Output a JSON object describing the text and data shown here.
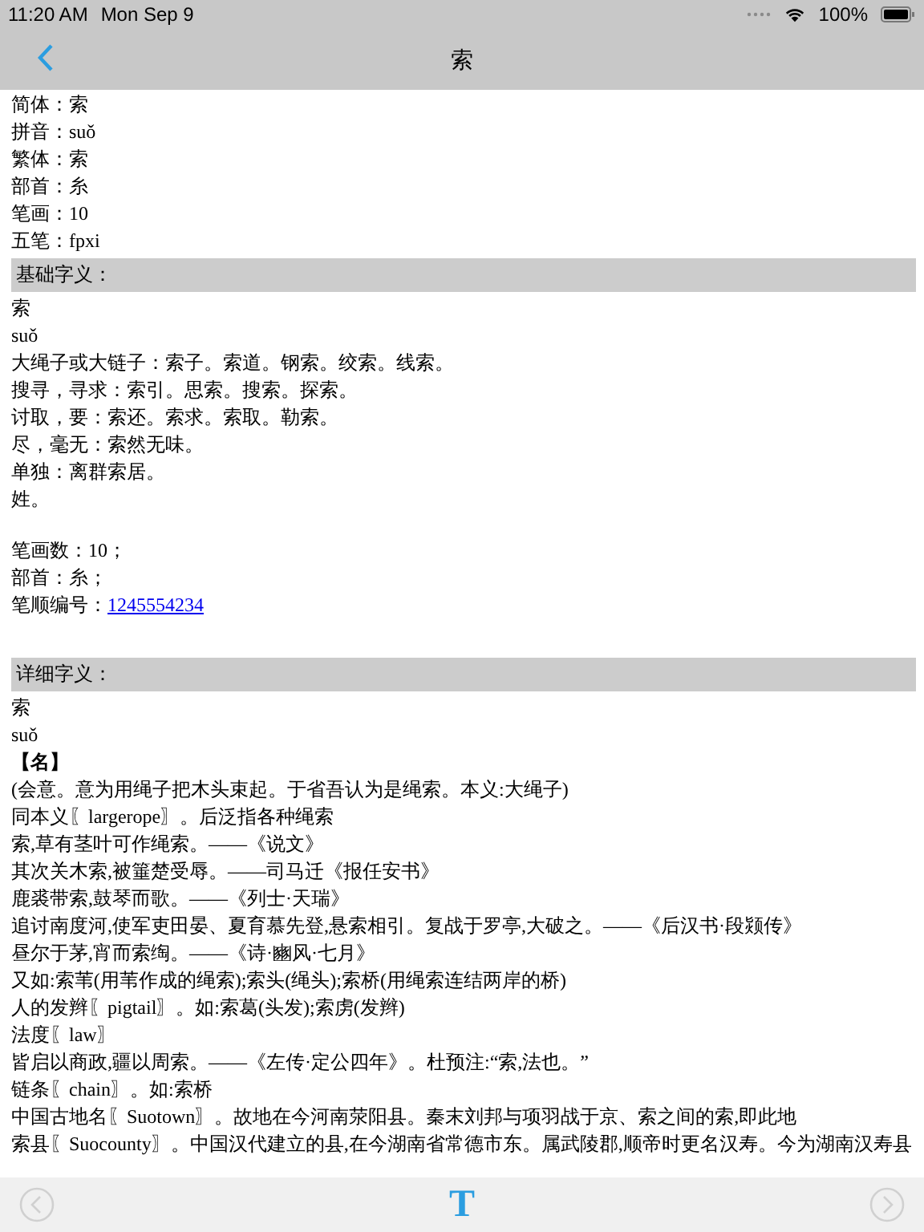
{
  "status_bar": {
    "time": "11:20 AM",
    "date": "Mon Sep 9",
    "battery": "100%"
  },
  "nav": {
    "title": "索"
  },
  "info": [
    {
      "label": "简体：",
      "value": "索"
    },
    {
      "label": "拼音：",
      "value": "suǒ"
    },
    {
      "label": "繁体：",
      "value": "索"
    },
    {
      "label": "部首：",
      "value": "糸"
    },
    {
      "label": "笔画：",
      "value": "10"
    },
    {
      "label": "五笔：",
      "value": "fpxi"
    }
  ],
  "basic_section": {
    "header": "基础字义：",
    "lines": [
      "索",
      "suǒ",
      "大绳子或大链子：索子。索道。钢索。绞索。线索。",
      "搜寻，寻求：索引。思索。搜索。探索。",
      "讨取，要：索还。索求。索取。勒索。",
      "尽，毫无：索然无味。",
      "单独：离群索居。",
      "姓。"
    ]
  },
  "stroke_info": [
    {
      "label": "笔画数：",
      "value": "10；",
      "kind": "plain"
    },
    {
      "label": "部首：",
      "value": "糸；",
      "kind": "plain"
    },
    {
      "label": "笔顺编号：",
      "value": "1245554234",
      "kind": "link"
    }
  ],
  "detail_section": {
    "header": "详细字义：",
    "lines": [
      {
        "text": "索",
        "kind": "plain"
      },
      {
        "text": "suǒ",
        "kind": "plain"
      },
      {
        "text": "【名】",
        "kind": "pos"
      },
      {
        "text": "(会意。意为用绳子把木头束起。于省吾认为是绳索。本义:大绳子)",
        "kind": "plain"
      },
      {
        "text": "同本义〖largerope〗。后泛指各种绳索",
        "kind": "plain"
      },
      {
        "text": "索,草有茎叶可作绳索。——《说文》",
        "kind": "plain"
      },
      {
        "text": "其次关木索,被箠楚受辱。——司马迁《报任安书》",
        "kind": "plain"
      },
      {
        "text": "鹿裘带索,鼓琴而歌。——《列士·天瑞》",
        "kind": "plain"
      },
      {
        "text": "追讨南度河,使军吏田晏、夏育慕先登,悬索相引。复战于罗亭,大破之。——《后汉书·段颎传》",
        "kind": "plain"
      },
      {
        "text": "昼尔于茅,宵而索绹。——《诗·豳风·七月》",
        "kind": "plain"
      },
      {
        "text": "又如:索苇(用苇作成的绳索);索头(绳头);索桥(用绳索连结两岸的桥)",
        "kind": "plain"
      },
      {
        "text": "人的发辫〖pigtail〗。如:索葛(头发);索虏(发辫)",
        "kind": "plain"
      },
      {
        "text": "法度〖law〗",
        "kind": "plain"
      },
      {
        "text": "皆启以商政,疆以周索。——《左传·定公四年》。杜预注:“索,法也。”",
        "kind": "plain"
      },
      {
        "text": "链条〖chain〗。如:索桥",
        "kind": "plain"
      },
      {
        "text": "中国古地名〖Suotown〗。故地在今河南荥阳县。秦末刘邦与项羽战于京、索之间的索,即此地",
        "kind": "plain"
      },
      {
        "text": "索县〖Suocounty〗。中国汉代建立的县,在今湖南省常德市东。属武陵郡,顺帝时更名汉寿。今为湖南汉寿县",
        "kind": "plain"
      }
    ]
  },
  "toolbar": {
    "prev": {
      "disabled": true
    },
    "font_button": "T",
    "next": {
      "disabled": true
    }
  }
}
